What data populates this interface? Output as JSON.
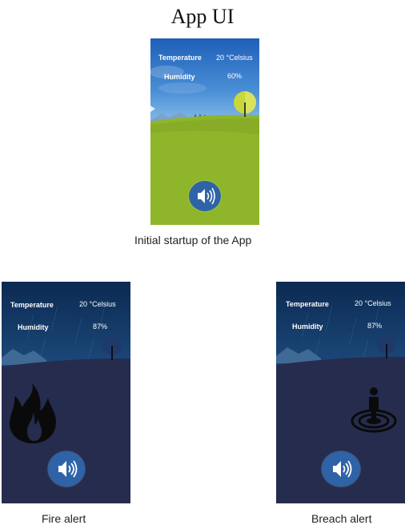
{
  "page_title": "App UI",
  "screens": {
    "startup": {
      "temperature_label": "Temperature",
      "temperature_value": "20 °Celsius",
      "humidity_label": "Humidity",
      "humidity_value": "60%",
      "caption": "Initial startup of the App",
      "icon": "speaker-icon",
      "colors": {
        "sky": "#2a6cc0",
        "grass": "#8fb52a",
        "tree": "#c8d83a"
      }
    },
    "fire": {
      "temperature_label": "Temperature",
      "temperature_value": "20 °Celsius",
      "humidity_label": "Humidity",
      "humidity_value": "87%",
      "caption": "Fire alert",
      "icon": "fire-icon",
      "colors": {
        "sky": "#0f2f5a",
        "ground": "#262c4e"
      }
    },
    "breach": {
      "temperature_label": "Temperature",
      "temperature_value": "20 °Celsius",
      "humidity_label": "Humidity",
      "humidity_value": "87%",
      "caption": "Breach alert",
      "icon": "person-target-icon",
      "colors": {
        "sky": "#0f2f5a",
        "ground": "#262c4e"
      }
    }
  }
}
